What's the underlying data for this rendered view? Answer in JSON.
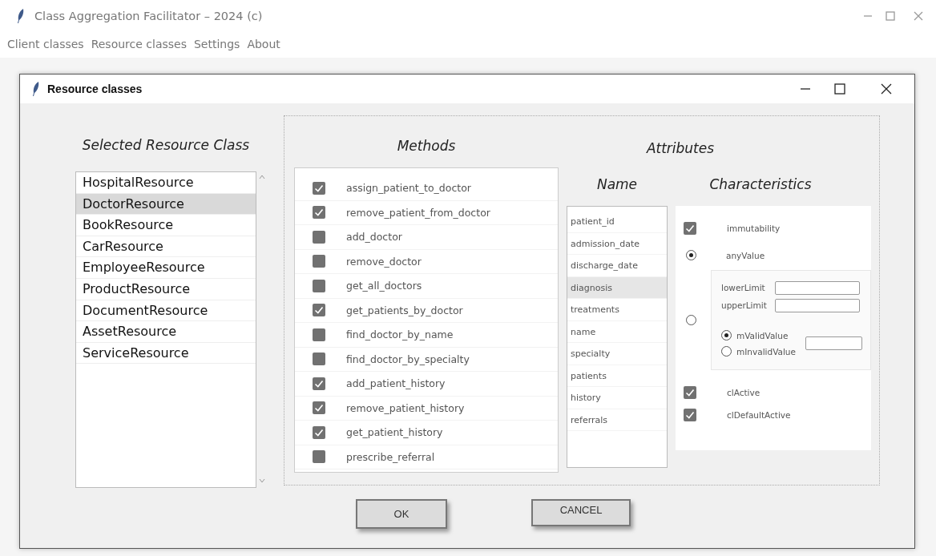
{
  "window": {
    "title": "Class Aggregation Facilitator – 2024 (c)"
  },
  "menu": [
    {
      "label": "Client classes"
    },
    {
      "label": "Resource classes"
    },
    {
      "label": "Settings"
    },
    {
      "label": "About"
    }
  ],
  "dialog": {
    "title": "Resource classes"
  },
  "resource_list": {
    "heading": "Selected Resource Class",
    "items": [
      {
        "label": "HospitalResource",
        "selected": false
      },
      {
        "label": "DoctorResource",
        "selected": true
      },
      {
        "label": "BookResource",
        "selected": false
      },
      {
        "label": "CarResource",
        "selected": false
      },
      {
        "label": "EmployeeResource",
        "selected": false
      },
      {
        "label": "ProductResource",
        "selected": false
      },
      {
        "label": "DocumentResource",
        "selected": false
      },
      {
        "label": "AssetResource",
        "selected": false
      },
      {
        "label": "ServiceResource",
        "selected": false
      }
    ]
  },
  "methods": {
    "heading": "Methods",
    "items": [
      {
        "label": "assign_patient_to_doctor",
        "checked": true
      },
      {
        "label": "remove_patient_from_doctor",
        "checked": true
      },
      {
        "label": "add_doctor",
        "checked": false
      },
      {
        "label": "remove_doctor",
        "checked": false
      },
      {
        "label": "get_all_doctors",
        "checked": false
      },
      {
        "label": "get_patients_by_doctor",
        "checked": true
      },
      {
        "label": "find_doctor_by_name",
        "checked": false
      },
      {
        "label": "find_doctor_by_specialty",
        "checked": false
      },
      {
        "label": "add_patient_history",
        "checked": true
      },
      {
        "label": "remove_patient_history",
        "checked": true
      },
      {
        "label": "get_patient_history",
        "checked": true
      },
      {
        "label": "prescribe_referral",
        "checked": false
      }
    ]
  },
  "attributes": {
    "heading": "Attributes",
    "name_heading": "Name",
    "characteristics_heading": "Characteristics",
    "names": [
      {
        "label": "patient_id",
        "selected": false
      },
      {
        "label": "admission_date",
        "selected": false
      },
      {
        "label": "discharge_date",
        "selected": false
      },
      {
        "label": "diagnosis",
        "selected": true
      },
      {
        "label": "treatments",
        "selected": false
      },
      {
        "label": "name",
        "selected": false
      },
      {
        "label": "specialty",
        "selected": false
      },
      {
        "label": "patients",
        "selected": false
      },
      {
        "label": "history",
        "selected": false
      },
      {
        "label": "referrals",
        "selected": false
      }
    ],
    "characteristics": {
      "immutability": {
        "label": "immutability",
        "checked": true
      },
      "any_value": {
        "label": "anyValue",
        "selected": true
      },
      "range": {
        "selected": false,
        "lower_limit": {
          "label": "lowerLimit"
        },
        "upper_limit": {
          "label": "upperLimit"
        },
        "valid_options": [
          {
            "label": "mValidValue",
            "selected": true
          },
          {
            "label": "mInvalidValue",
            "selected": false
          }
        ]
      },
      "flags": [
        {
          "label": "clActive",
          "checked": true
        },
        {
          "label": "clDefaultActive",
          "checked": true
        }
      ]
    }
  },
  "buttons": [
    {
      "label": "OK"
    },
    {
      "label": "CANCEL"
    }
  ]
}
